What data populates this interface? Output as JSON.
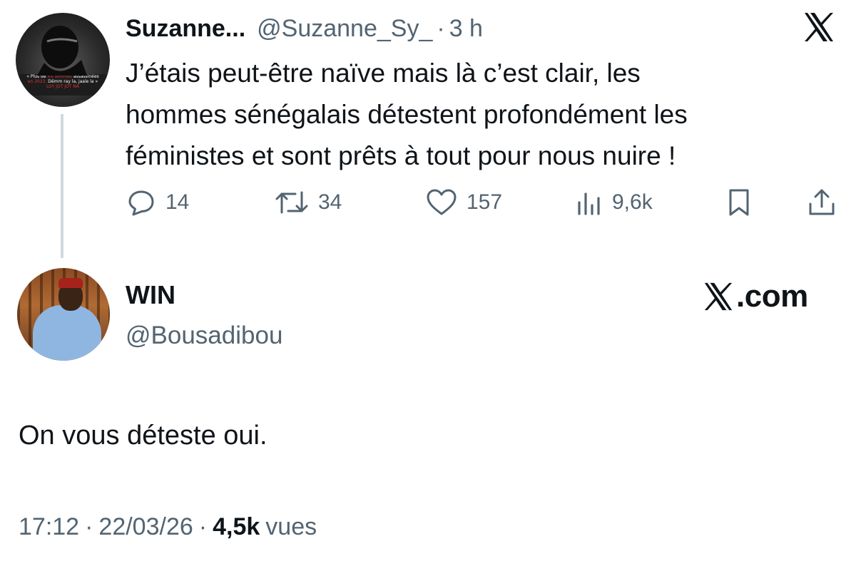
{
  "quoted_tweet": {
    "display_name": "Suzanne...",
    "handle": "@Suzanne_Sy_",
    "separator": "·",
    "time": "3 h",
    "text_lines": [
      "J’étais peut-être naïve mais là c’est clair, les",
      "hommes sénégalais détestent profondément les",
      "féministes et sont prêts à tout pour nous nuire !"
    ],
    "avatar_text": {
      "line1_prefix": "« Plus de",
      "line1_red": "XX femmes",
      "line1_suffix": "assassinées",
      "line2_red": "en 2023.",
      "line2_suffix": "Dëmm ray la, jaale la »",
      "line3": "LUY JOT JOT NA"
    },
    "actions": {
      "replies": "14",
      "reposts": "34",
      "likes": "157",
      "views": "9,6k"
    },
    "icons": {
      "close": "x-logo-icon",
      "reply": "reply-bubble-icon",
      "repost": "repost-icon",
      "like": "heart-icon",
      "views": "bar-chart-icon",
      "bookmark": "bookmark-icon",
      "share": "share-icon"
    }
  },
  "reply_tweet": {
    "display_name": "WIN",
    "handle": "@Bousadibou",
    "brand": ".com",
    "text": "On vous déteste oui.",
    "time": "17:12",
    "separator": "·",
    "date": "22/03/26",
    "views_count": "4,5k",
    "views_label": "vues"
  },
  "colors": {
    "text_primary": "#0f1419",
    "text_secondary": "#536471",
    "thread_line": "#cfd9de",
    "background": "#ffffff"
  }
}
